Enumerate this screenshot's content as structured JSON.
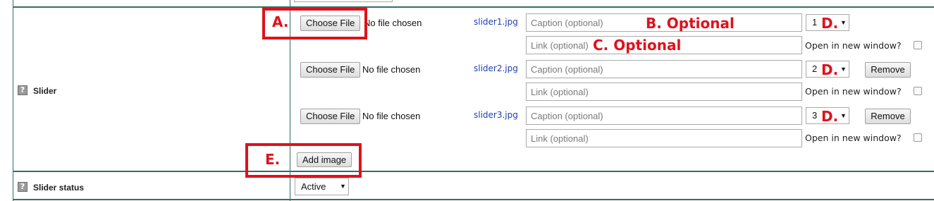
{
  "slider_row": {
    "label": "Slider",
    "help_icon": "?",
    "add_image_label": "Add image",
    "entries": [
      {
        "choose_file_label": "Choose File",
        "no_file_text": "No file chosen",
        "filename": "slider1.jpg",
        "caption_placeholder": "Caption (optional)",
        "link_placeholder": "Link (optional)",
        "order": "1",
        "new_window_label": "Open in new window?"
      },
      {
        "choose_file_label": "Choose File",
        "no_file_text": "No file chosen",
        "filename": "slider2.jpg",
        "caption_placeholder": "Caption (optional)",
        "link_placeholder": "Link (optional)",
        "order": "2",
        "remove_label": "Remove",
        "new_window_label": "Open in new window?"
      },
      {
        "choose_file_label": "Choose File",
        "no_file_text": "No file chosen",
        "filename": "slider3.jpg",
        "caption_placeholder": "Caption (optional)",
        "link_placeholder": "Link (optional)",
        "order": "3",
        "remove_label": "Remove",
        "new_window_label": "Open in new window?"
      }
    ]
  },
  "status_row": {
    "label": "Slider status",
    "help_icon": "?",
    "value": "Active"
  },
  "annotations": {
    "a": "A.",
    "b": "B. Optional",
    "c": "C. Optional",
    "d": "D.",
    "e": "E."
  },
  "colors": {
    "annotation": "#e0111b",
    "table_border": "#2f6f6a",
    "filename_link": "#1f3fb0"
  },
  "icons": {
    "help": "help-icon",
    "dropdown": "caret-down-icon"
  }
}
